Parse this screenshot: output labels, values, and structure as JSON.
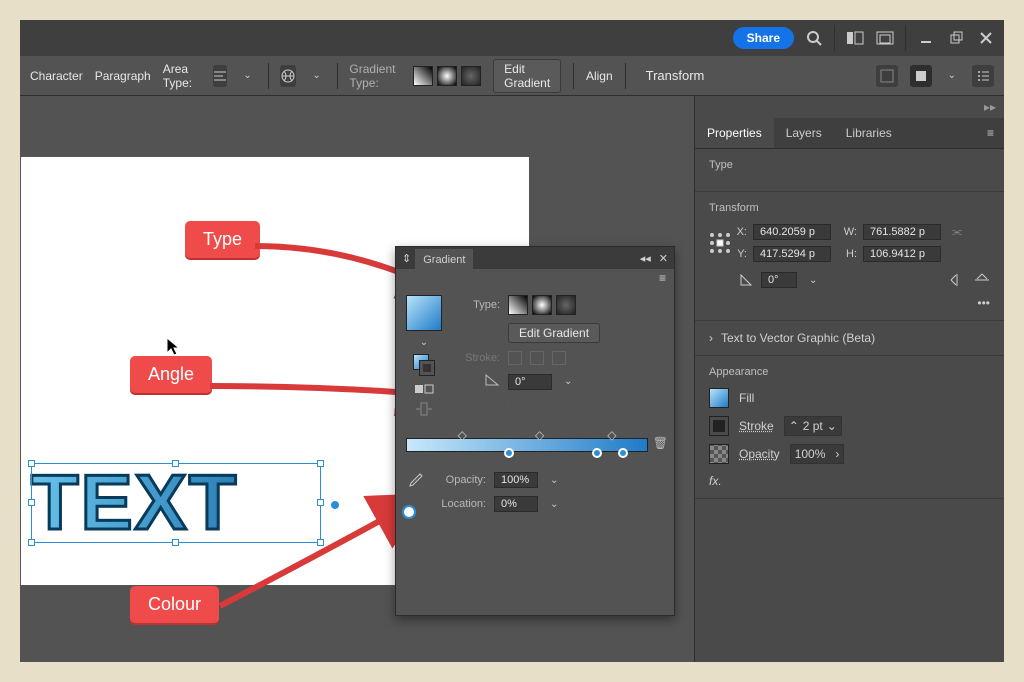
{
  "titlebar": {
    "share": "Share"
  },
  "optionbar": {
    "char": "Character",
    "para": "Paragraph",
    "area": "Area Type:",
    "gradtype": "Gradient Type:",
    "edit": "Edit Gradient",
    "align": "Align",
    "transform": "Transform"
  },
  "panels": {
    "props": "Properties",
    "layers": "Layers",
    "libs": "Libraries",
    "type_section": "Type",
    "transform_section": "Transform",
    "x_label": "X:",
    "y_label": "Y:",
    "w_label": "W:",
    "h_label": "H:",
    "x": "640.2059 p",
    "y": "417.5294 p",
    "w": "761.5882 p",
    "h": "106.9412 p",
    "rotate": "0°",
    "vector": "Text to Vector Graphic (Beta)",
    "appearance": "Appearance",
    "fill": "Fill",
    "stroke": "Stroke",
    "stroke_val": "2 pt",
    "opacity": "Opacity",
    "opacity_val": "100%",
    "fx": "fx."
  },
  "gradient": {
    "title": "Gradient",
    "type_label": "Type:",
    "edit": "Edit Gradient",
    "stroke": "Stroke:",
    "angle": "0°",
    "opacity_label": "Opacity:",
    "opacity": "100%",
    "location_label": "Location:",
    "location": "0%"
  },
  "canvas": {
    "text": "TEXT"
  },
  "callouts": {
    "type": "Type",
    "angle": "Angle",
    "colour": "Colour"
  }
}
